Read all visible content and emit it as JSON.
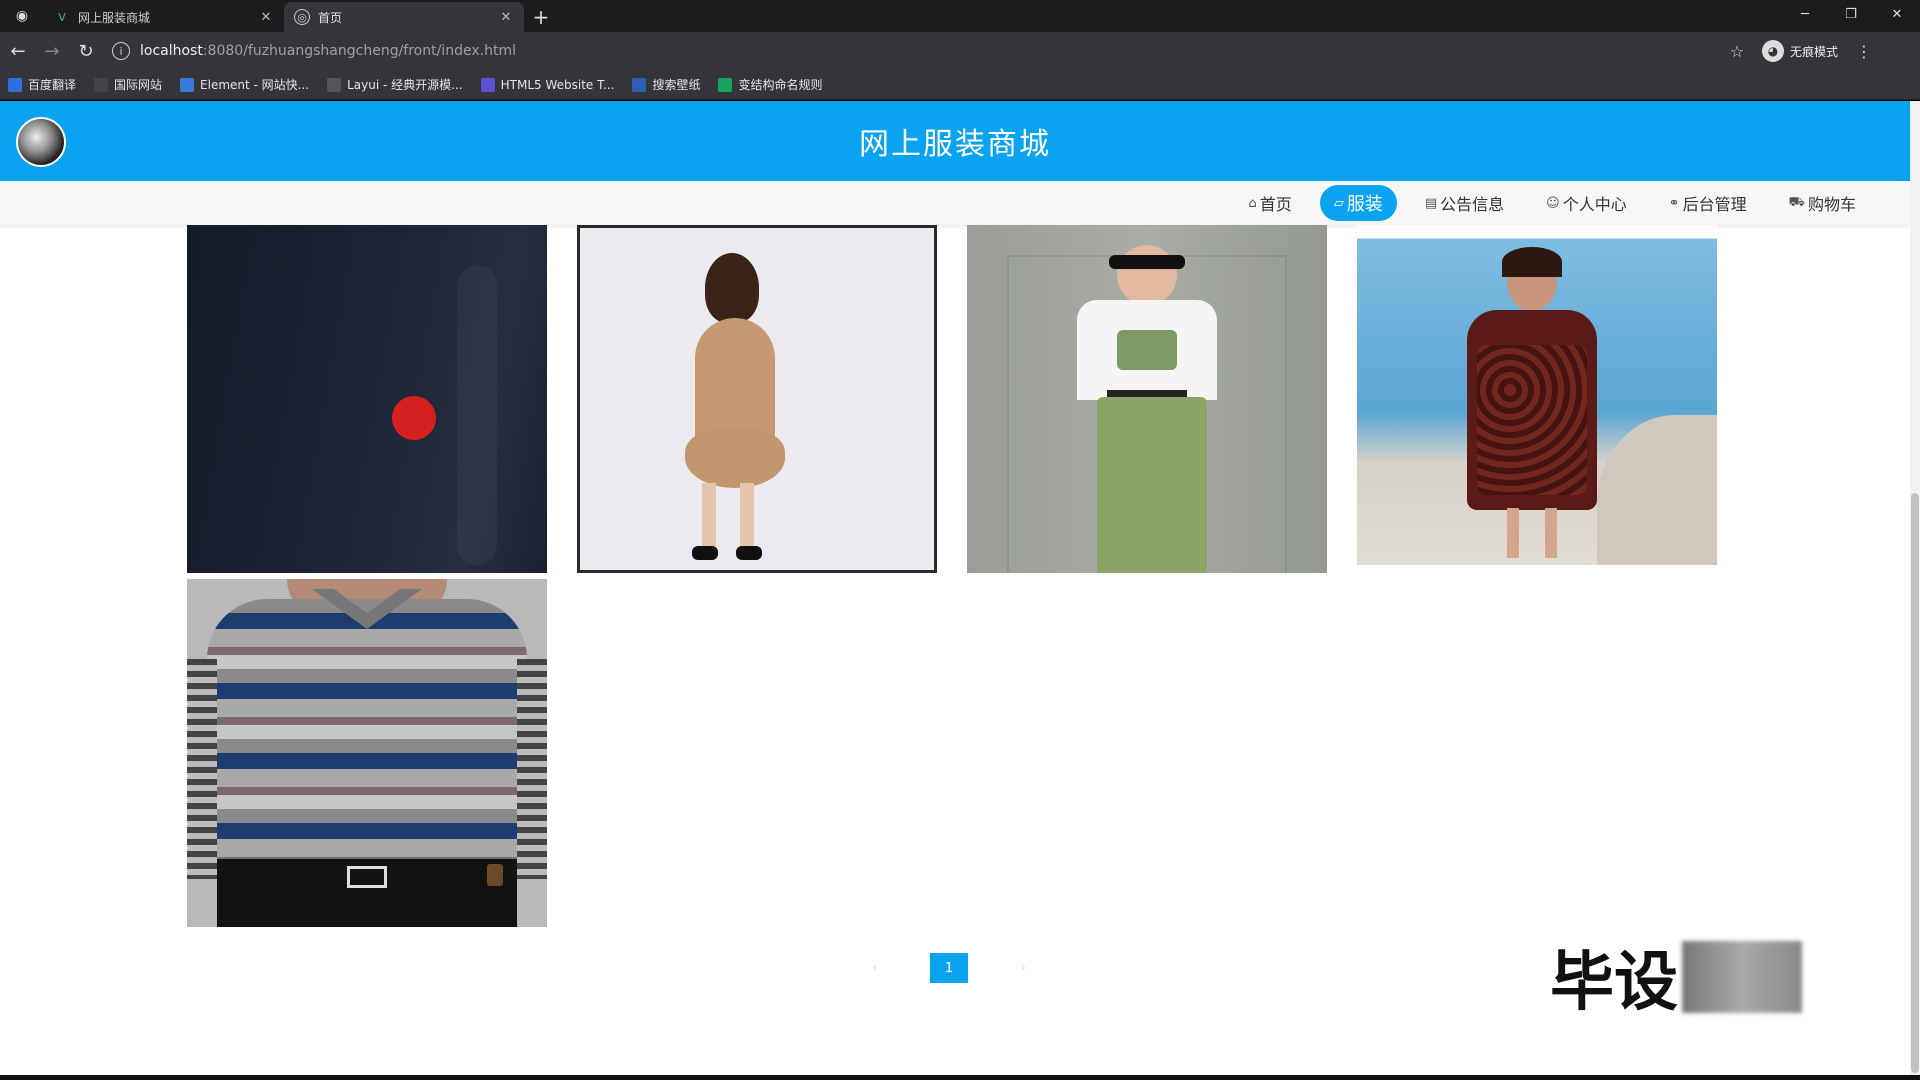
{
  "browser": {
    "tabs": [
      {
        "title": "网上服装商城",
        "active": false
      },
      {
        "title": "首页",
        "active": true
      }
    ],
    "new_tab": "+",
    "url_host": "localhost",
    "url_path": ":8080/fuzhuangshangcheng/front/index.html",
    "profile_label": "无痕模式",
    "bookmarks": [
      {
        "label": "百度翻译",
        "color": "#2f6fe0"
      },
      {
        "label": "国际网站",
        "color": "#444444"
      },
      {
        "label": "Element - 网站快...",
        "color": "#3a7bd5"
      },
      {
        "label": "Layui - 经典开源模...",
        "color": "#555555"
      },
      {
        "label": "HTML5 Website T...",
        "color": "#5b4fd6"
      },
      {
        "label": "搜索壁纸",
        "color": "#2c5fb3"
      },
      {
        "label": "变结构命名规则",
        "color": "#1aa260"
      }
    ]
  },
  "site": {
    "title": "网上服装商城",
    "nav": [
      {
        "label": "首页",
        "icon": "home-icon",
        "glyph": "⌂",
        "active": false
      },
      {
        "label": "服装",
        "icon": "clothing-icon",
        "glyph": "▱",
        "active": true
      },
      {
        "label": "公告信息",
        "icon": "notice-icon",
        "glyph": "▤",
        "active": false
      },
      {
        "label": "个人中心",
        "icon": "user-icon",
        "glyph": "☺",
        "active": false
      },
      {
        "label": "后台管理",
        "icon": "link-icon",
        "glyph": "⚭",
        "active": false
      },
      {
        "label": "购物车",
        "icon": "cart-icon",
        "glyph": "⛟",
        "active": false
      }
    ],
    "products": [
      {
        "name": "dark-jacket-product",
        "bg": "#1c2434"
      },
      {
        "name": "tan-ruffle-dress-product",
        "bg": "#e9e7ea"
      },
      {
        "name": "white-tee-green-skirt-product",
        "bg": "#9fa39c"
      },
      {
        "name": "floral-dress-product",
        "bg": "#6fb0d8"
      },
      {
        "name": "striped-polo-product",
        "bg": "#9c9c9c"
      }
    ],
    "pagination": {
      "current": "1"
    }
  },
  "watermark": {
    "text": "毕设"
  },
  "colors": {
    "brand": "#0aa3ef",
    "cursor": "#d62020"
  }
}
